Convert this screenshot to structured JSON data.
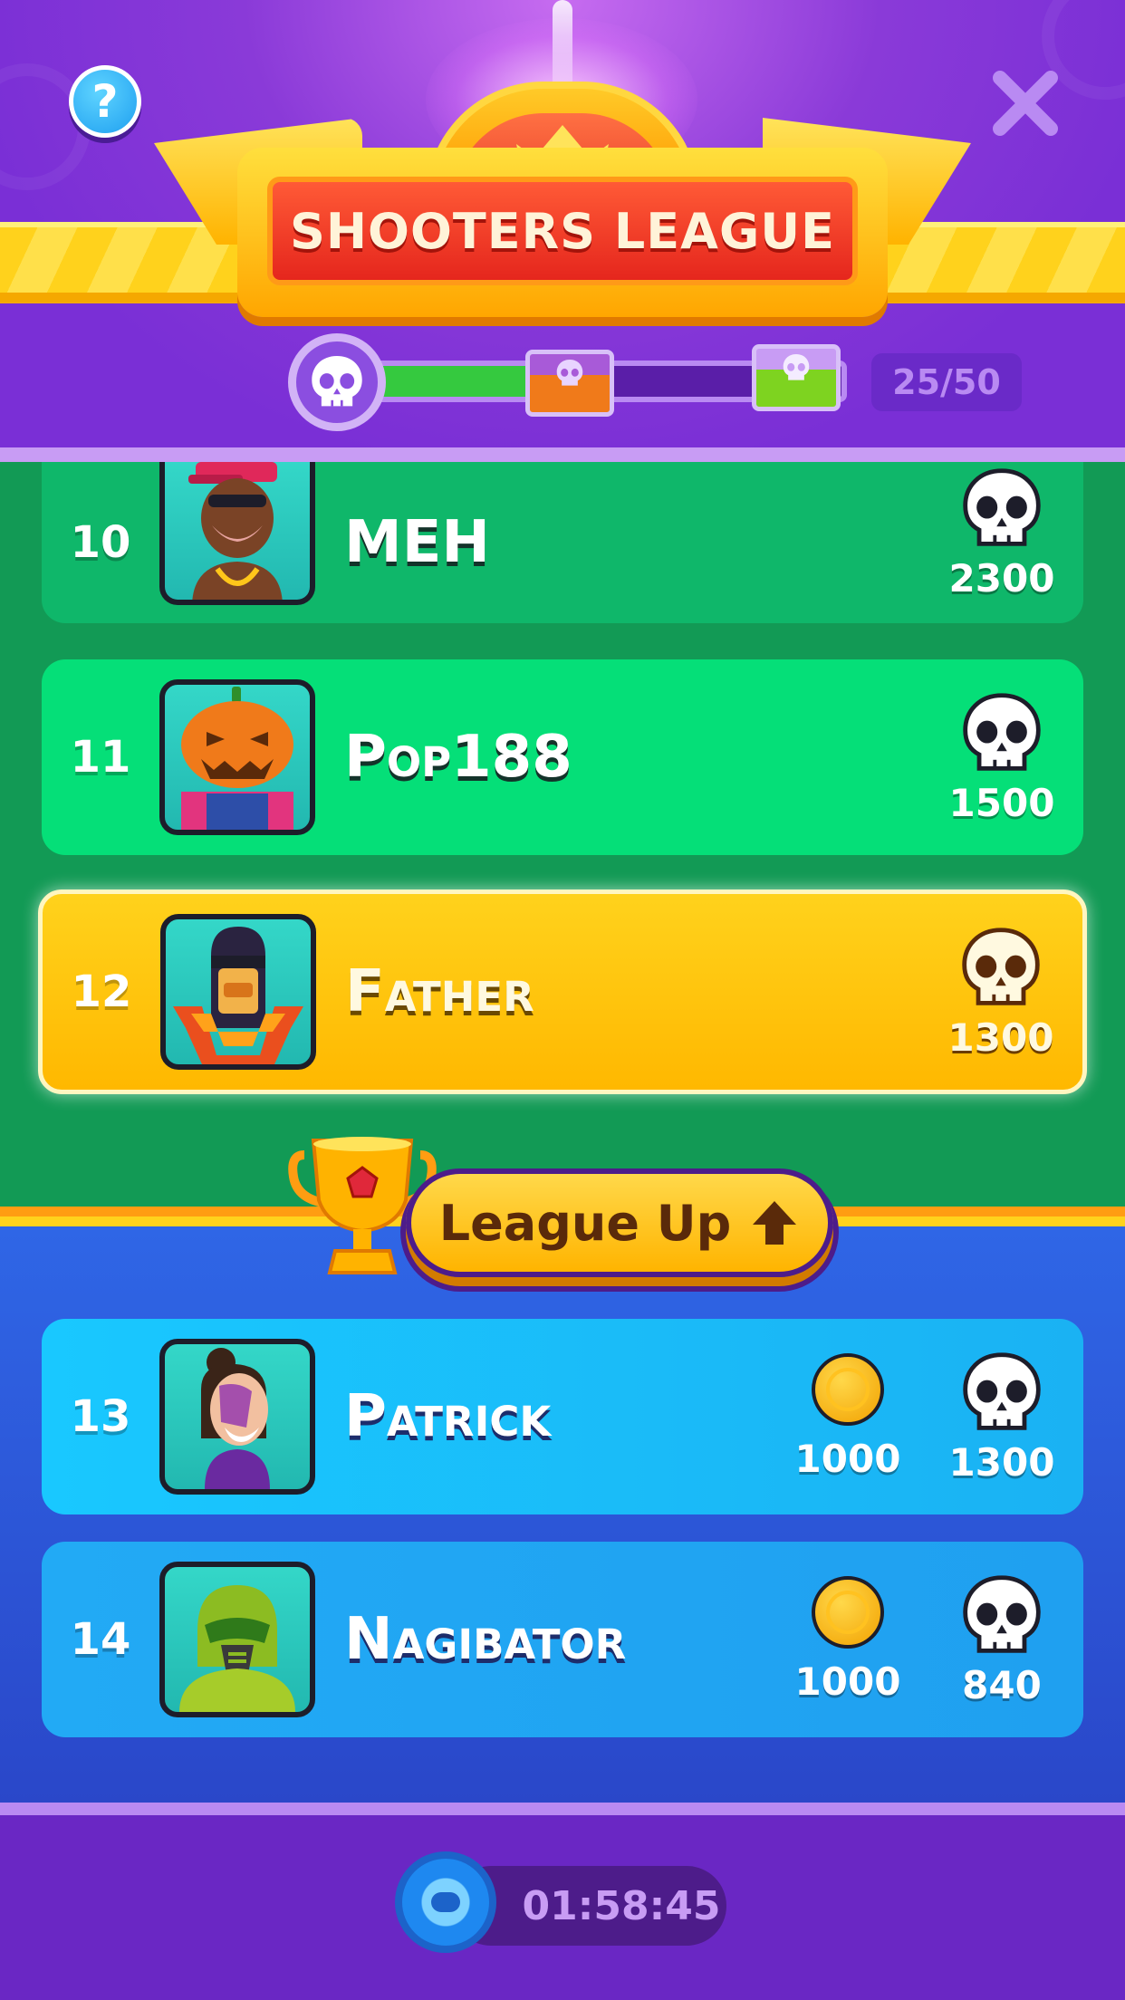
{
  "header": {
    "title": "SHOOTERS LEAGUE",
    "help_icon": "question-icon",
    "close_icon": "close-icon",
    "progress": {
      "current": 25,
      "total": 50,
      "label": "25/50",
      "fraction": 0.5
    }
  },
  "rows": [
    {
      "rank": "10",
      "name": "MEH",
      "skulls": "2300",
      "avatar": "dreadlocks-cap-character",
      "zone": "league-up"
    },
    {
      "rank": "11",
      "name": "Pop188",
      "skulls": "1500",
      "avatar": "pumpkin-head-character",
      "zone": "league-up"
    },
    {
      "rank": "12",
      "name": "Father",
      "skulls": "1300",
      "avatar": "masked-flame-character",
      "zone": "league-up",
      "highlighted": true
    },
    {
      "rank": "13",
      "name": "Patrick",
      "coins": "1000",
      "skulls": "1300",
      "avatar": "purple-hair-character",
      "zone": "stay"
    },
    {
      "rank": "14",
      "name": "Nagibator",
      "coins": "1000",
      "skulls": "840",
      "avatar": "gas-mask-character",
      "zone": "stay"
    }
  ],
  "league_up": {
    "label": "League Up",
    "icon": "arrow-up-icon"
  },
  "footer": {
    "timer": "01:58:45",
    "icon": "stopwatch-icon"
  },
  "colors": {
    "header_purple": "#7a2fd6",
    "green_zone": "#129a55",
    "highlight_gold": "#ffc107",
    "blue_zone": "#2f66e6",
    "progress_green": "#35c93f"
  }
}
